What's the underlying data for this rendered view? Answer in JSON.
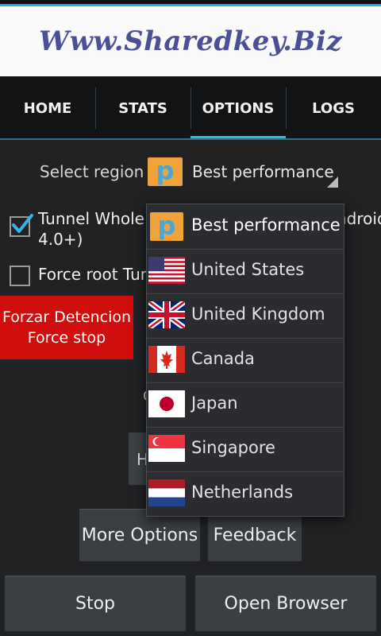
{
  "banner": {
    "text": "Www.Sharedkey.Biz"
  },
  "tabs": [
    {
      "label": "HOME",
      "active": false
    },
    {
      "label": "STATS",
      "active": false
    },
    {
      "label": "OPTIONS",
      "active": true
    },
    {
      "label": "LOGS",
      "active": false
    }
  ],
  "region": {
    "label": "Select region",
    "selected": "Best performance"
  },
  "options": {
    "tunnel_whole_a": "Tunnel Whole D",
    "tunnel_whole_b": "ndroid",
    "tunnel_whole_line2": "4.0+)",
    "tunnel_whole_checked": true,
    "force_root": "Force root Tun",
    "force_root_checked": false
  },
  "force_stop": {
    "line1": "Forzar Detencion",
    "line2": "Force stop"
  },
  "partial": {
    "hidden_button": "H",
    "small_text": "C"
  },
  "dropdown": {
    "items": [
      {
        "label": "Best performance",
        "icon": "p-logo-icon"
      },
      {
        "label": "United States",
        "icon": "us-flag-icon"
      },
      {
        "label": "United Kingdom",
        "icon": "uk-flag-icon"
      },
      {
        "label": "Canada",
        "icon": "canada-flag-icon"
      },
      {
        "label": "Japan",
        "icon": "japan-flag-icon"
      },
      {
        "label": "Singapore",
        "icon": "singapore-flag-icon"
      },
      {
        "label": "Netherlands",
        "icon": "netherlands-flag-icon"
      }
    ]
  },
  "buttons": {
    "more_options": "More Options",
    "feedback": "Feedback",
    "stop": "Stop",
    "open_browser": "Open Browser"
  },
  "icons": {
    "p_logo_letter": "p"
  },
  "colors": {
    "accent": "#33b5e5",
    "force_stop": "#d10e0e",
    "p_logo_bg": "#f0a23b",
    "p_logo_fg": "#49a7d8"
  }
}
